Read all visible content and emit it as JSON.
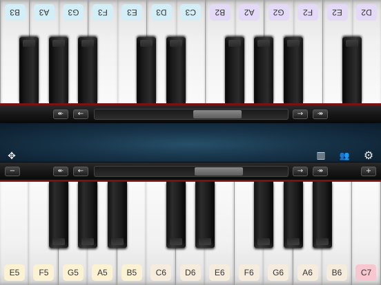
{
  "top_keyboard": {
    "white_keys": [
      {
        "label": "D2",
        "color": "#e4d9f7"
      },
      {
        "label": "E2",
        "color": "#e4d9f7"
      },
      {
        "label": "F2",
        "color": "#e4d9f7"
      },
      {
        "label": "G2",
        "color": "#e4d9f7"
      },
      {
        "label": "A2",
        "color": "#e4d9f7"
      },
      {
        "label": "B2",
        "color": "#e4d9f7"
      },
      {
        "label": "C3",
        "color": "#d3eef7"
      },
      {
        "label": "D3",
        "color": "#d3eef7"
      },
      {
        "label": "E3",
        "color": "#d3eef7"
      },
      {
        "label": "F3",
        "color": "#d3eef7"
      },
      {
        "label": "G3",
        "color": "#d3eef7"
      },
      {
        "label": "A3",
        "color": "#d3eef7"
      },
      {
        "label": "B3",
        "color": "#d3eef7"
      }
    ]
  },
  "bottom_keyboard": {
    "white_keys": [
      {
        "label": "E5",
        "color": "#fbf2d4"
      },
      {
        "label": "F5",
        "color": "#fbf2d4"
      },
      {
        "label": "G5",
        "color": "#fbf2d4"
      },
      {
        "label": "A5",
        "color": "#fbf2d4"
      },
      {
        "label": "B5",
        "color": "#fbf2d4"
      },
      {
        "label": "C6",
        "color": "#f6ecdd"
      },
      {
        "label": "D6",
        "color": "#f6ecdd"
      },
      {
        "label": "E6",
        "color": "#f6ecdd"
      },
      {
        "label": "F6",
        "color": "#f6ecdd"
      },
      {
        "label": "G6",
        "color": "#f6ecdd"
      },
      {
        "label": "A6",
        "color": "#f6ecdd"
      },
      {
        "label": "B6",
        "color": "#f6ecdd"
      },
      {
        "label": "C7",
        "color": "#f7c6cf"
      }
    ]
  },
  "top_scroll": {
    "page_left": "↞",
    "step_left": "←",
    "step_right": "→",
    "page_right": "↠",
    "position": 0.68
  },
  "bottom_scroll": {
    "minus": "−",
    "page_left": "↞",
    "step_left": "←",
    "step_right": "→",
    "page_right": "↠",
    "plus": "+",
    "position": 0.69
  },
  "panel": {
    "move_icon": "✥",
    "keyboard_icon": "▥",
    "users_icon": "👥",
    "settings_icon": "⚙"
  },
  "colors": {
    "accent_red": "#7b1212",
    "panel_blue": "#1d3f57"
  }
}
